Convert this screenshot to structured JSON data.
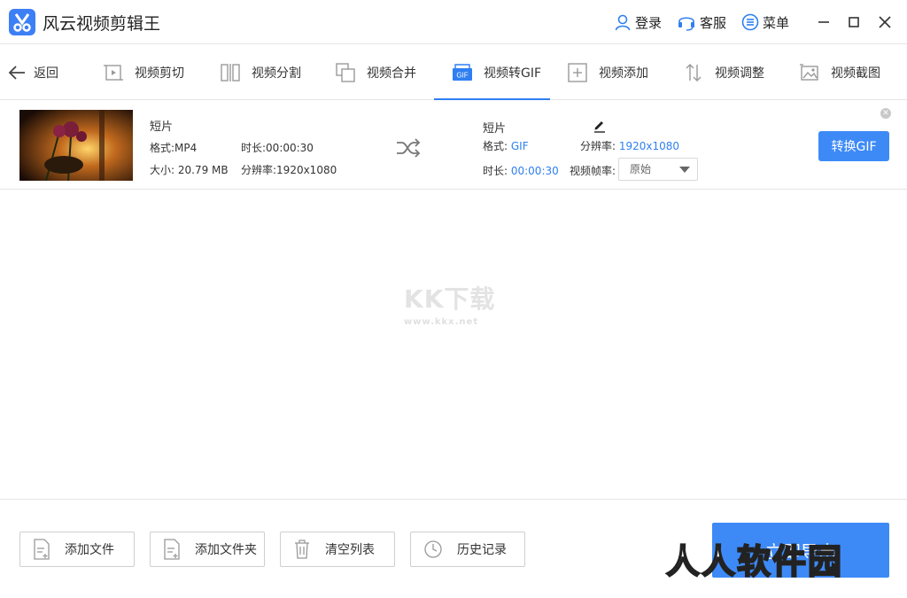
{
  "app": {
    "title": "风云视频剪辑王"
  },
  "header": {
    "login_label": "登录",
    "service_label": "客服",
    "menu_label": "菜单"
  },
  "toolbar": {
    "back_label": "返回",
    "tabs": [
      {
        "label": "视频剪切",
        "icon": "video-cut-icon"
      },
      {
        "label": "视频分割",
        "icon": "video-split-icon"
      },
      {
        "label": "视频合并",
        "icon": "video-merge-icon"
      },
      {
        "label": "视频转GIF",
        "icon": "gif-icon",
        "active": true
      },
      {
        "label": "视频添加",
        "icon": "video-add-icon"
      },
      {
        "label": "视频调整",
        "icon": "video-adjust-icon"
      },
      {
        "label": "视频截图",
        "icon": "screenshot-icon"
      }
    ],
    "gif_badge": "GIF"
  },
  "file": {
    "source": {
      "name": "短片",
      "format_label": "格式:MP4",
      "duration_label": "时长:00:00:30",
      "size_label": "大小: 20.79 MB",
      "resolution_label": "分辨率:1920x1080"
    },
    "output": {
      "name": "短片",
      "format_key": "格式: ",
      "format_value": "GIF",
      "resolution_key": "分辨率: ",
      "resolution_value": "1920x1080",
      "duration_key": "时长: ",
      "duration_value": "00:00:30",
      "framerate_key": "视频帧率:",
      "framerate_value": "原始"
    },
    "convert_button": "转换GIF"
  },
  "watermark": {
    "center_big": "KK下载",
    "center_small": "www.kkx.net",
    "corner": "人人软件园"
  },
  "bottom": {
    "add_file": "添加文件",
    "add_folder": "添加文件夹",
    "clear_list": "清空列表",
    "history": "历史记录",
    "export": "立即导出"
  },
  "colors": {
    "accent": "#3d8af7",
    "tab_underline": "#2f7ff2",
    "link_blue": "#2f7ff2"
  }
}
